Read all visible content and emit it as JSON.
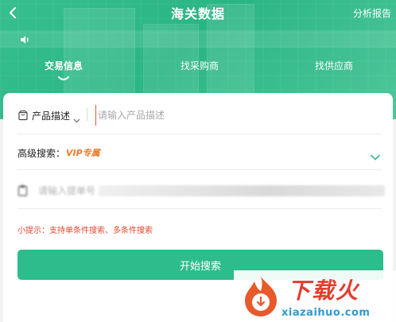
{
  "header": {
    "title": "海关数据",
    "right_link": "分析报告"
  },
  "tabs": [
    {
      "label": "交易信息",
      "active": true
    },
    {
      "label": "找采购商",
      "active": false
    },
    {
      "label": "找供应商",
      "active": false
    }
  ],
  "form": {
    "product_type": "产品描述",
    "product_placeholder": "请输入产品描述",
    "advanced_label": "高级搜索：",
    "vip_badge": "VIP专属",
    "bill_placeholder": "请输入提单号",
    "tip": "小提示：支持单条件搜索、多条件搜索",
    "search_button": "开始搜索"
  },
  "watermark": {
    "text": "下载火",
    "url": "xiazaihuo.com"
  },
  "colors": {
    "brand": "#2dbd8c",
    "vip": "#f07b2b",
    "tip": "#e1482f",
    "watermark": "#e43c2c"
  },
  "icons": {
    "back": "chevron-left-icon",
    "notice": "speaker-icon",
    "product": "shopping-bag-icon",
    "dropdown": "caret-down-icon",
    "advanced": "chevron-down-icon",
    "bill": "clipboard-icon"
  }
}
